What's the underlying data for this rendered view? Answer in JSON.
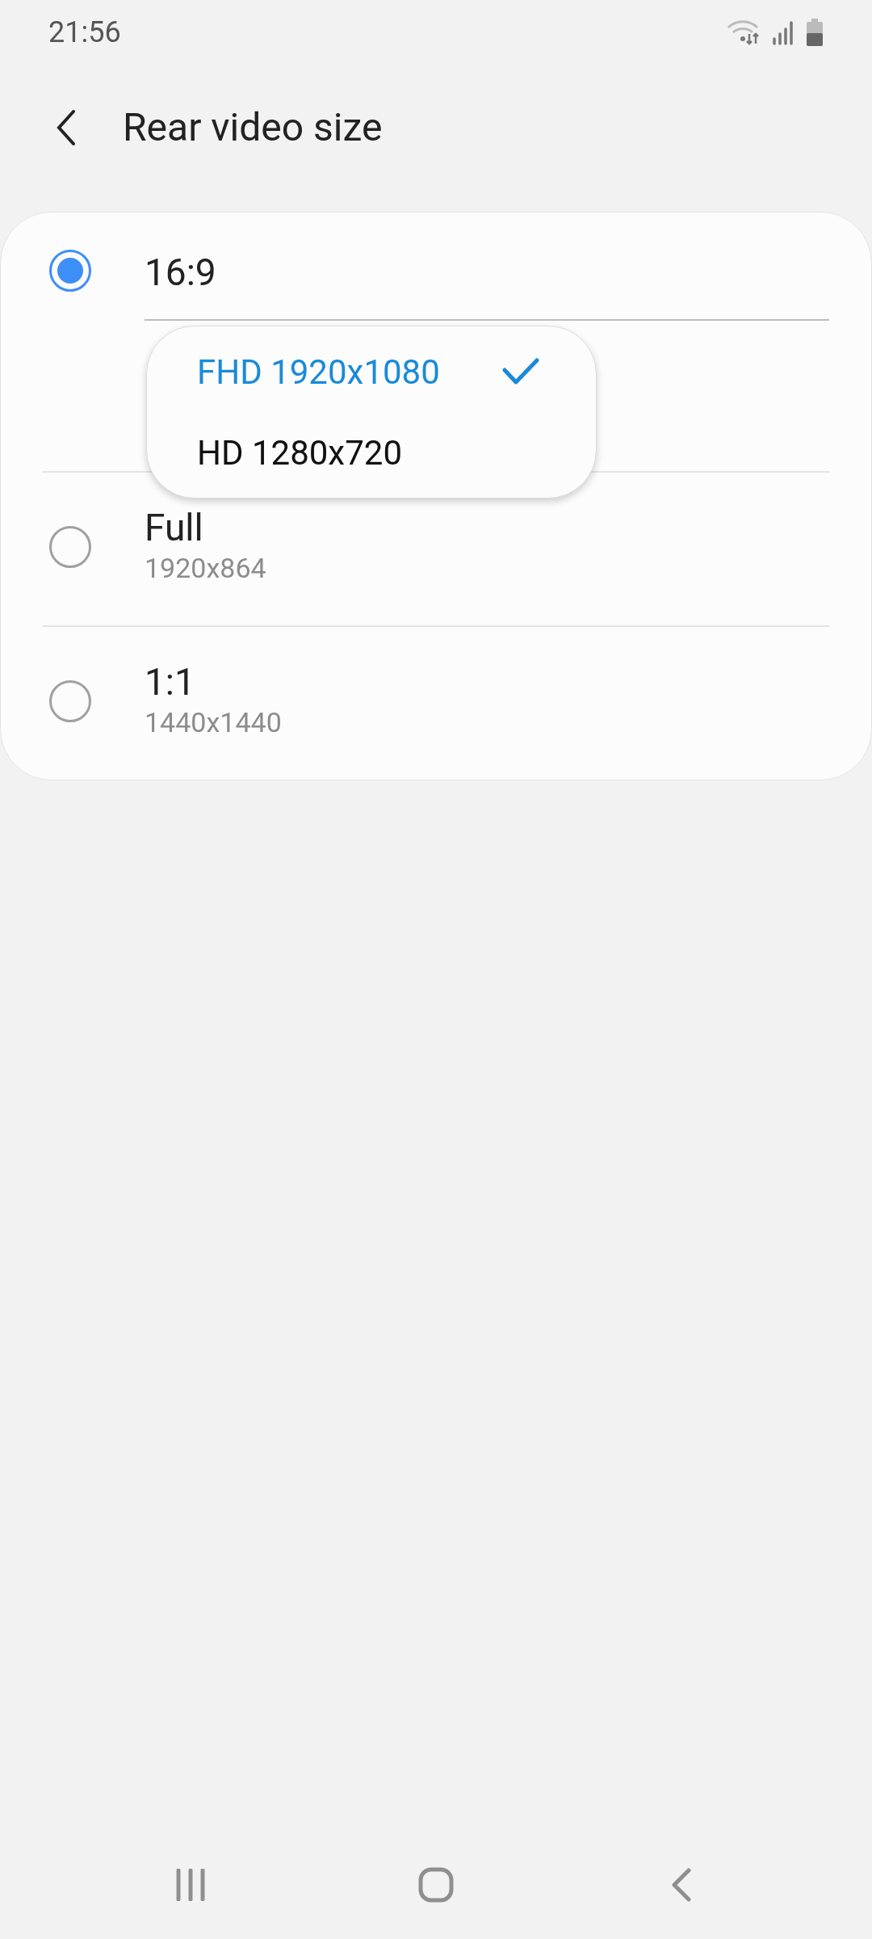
{
  "status_bar": {
    "time": "21:56"
  },
  "header": {
    "title": "Rear video size"
  },
  "options": [
    {
      "title": "16:9",
      "selected": true
    },
    {
      "title": "Full",
      "subtitle": "1920x864",
      "selected": false
    },
    {
      "title": "1:1",
      "subtitle": "1440x1440",
      "selected": false
    }
  ],
  "popup": {
    "items": [
      {
        "label": "FHD 1920x1080",
        "selected": true
      },
      {
        "label": "HD 1280x720",
        "selected": false
      }
    ]
  }
}
